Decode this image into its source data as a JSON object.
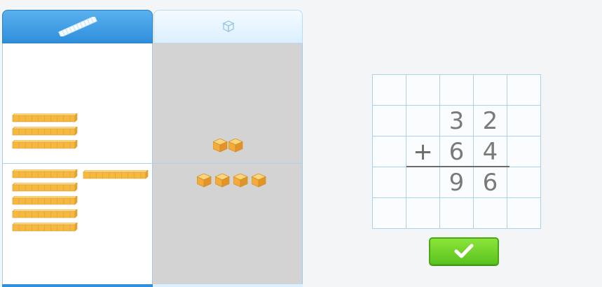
{
  "tabs": [
    {
      "id": "tens",
      "icon": "ten-rod-icon",
      "selected": true
    },
    {
      "id": "ones",
      "icon": "unit-cube-icon",
      "selected": false
    }
  ],
  "blocks": {
    "top_row": {
      "tens": 3,
      "ones": 2
    },
    "bottom_row": {
      "tens": 6,
      "ones": 4
    }
  },
  "addition": {
    "operator": "+",
    "addend1": [
      "3",
      "2"
    ],
    "addend2": [
      "6",
      "4"
    ],
    "sum": [
      "9",
      "6"
    ]
  },
  "colors": {
    "rod": "#f5b942",
    "cube": "#f0a93a",
    "tab_active": "#2f8fdc",
    "grid_line": "#a9d3ec",
    "check_button": "#6fd22a"
  },
  "check_button": {
    "icon": "checkmark-icon"
  }
}
